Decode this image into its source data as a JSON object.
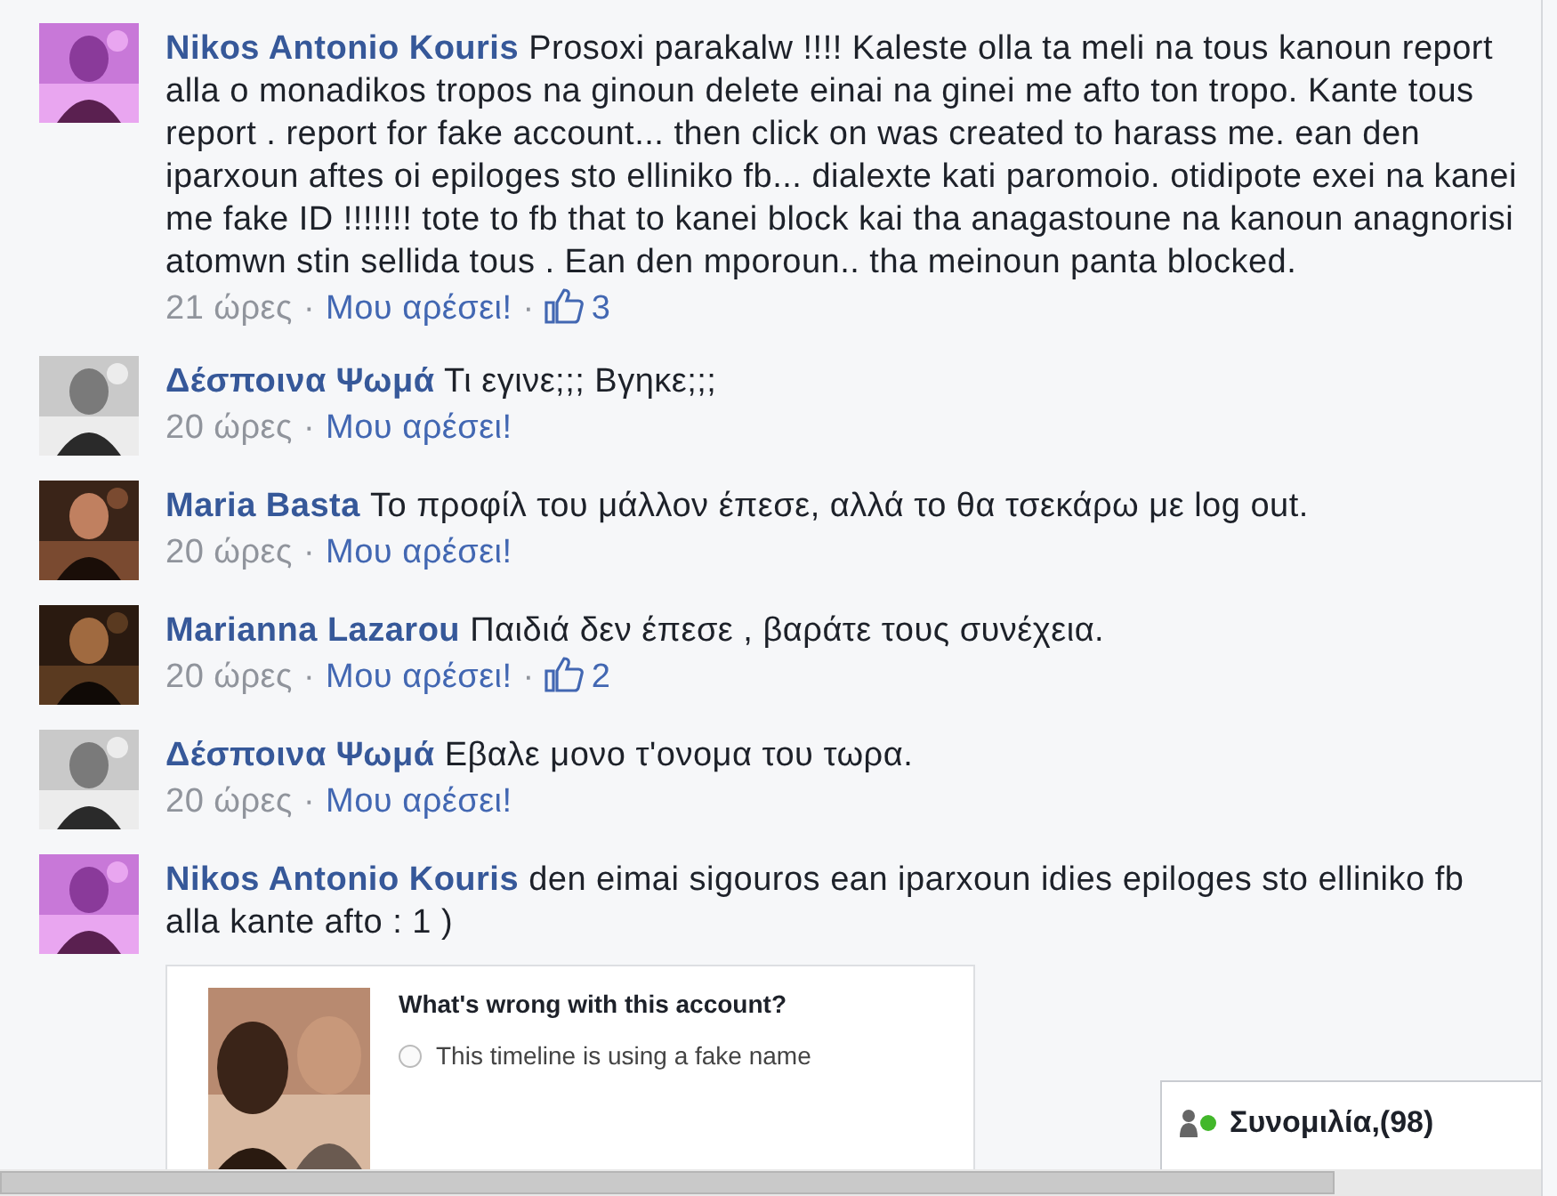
{
  "comments": [
    {
      "author": "Nikos Antonio Kouris",
      "text": "Prosoxi parakalw !!!! Kaleste olla ta meli na tous kanoun report alla o monadikos tropos na ginoun delete einai na ginei me afto ton tropo. Kante tous report . report for fake account... then click on was created to harass me. ean den iparxoun aftes oi epiloges sto elliniko fb... dialexte kati paromoio. otidipote exei na kanei me fake ID !!!!!!! tote to fb that to kanei block kai tha anagastoune na kanoun anagnorisi atomwn stin sellida tous . Ean den mporoun.. tha meinoun panta blocked.",
      "meta": [
        {
          "kind": "time",
          "text": "21 ώρες"
        },
        {
          "kind": "separator",
          "text": "·"
        },
        {
          "kind": "like",
          "text": "Μου αρέσει!"
        },
        {
          "kind": "separator",
          "text": "·"
        },
        {
          "kind": "count",
          "text": "3"
        }
      ]
    },
    {
      "author": "Δέσποινα Ψωμά",
      "text": "Τι εγινε;;; Βγηκε;;;",
      "meta": [
        {
          "kind": "time",
          "text": "20 ώρες"
        },
        {
          "kind": "separator",
          "text": "·"
        },
        {
          "kind": "like",
          "text": "Μου αρέσει!"
        }
      ]
    },
    {
      "author": "Maria Basta",
      "text": "Το προφίλ του μάλλον έπεσε, αλλά το θα τσεκάρω με log out.",
      "meta": [
        {
          "kind": "time",
          "text": "20 ώρες"
        },
        {
          "kind": "separator",
          "text": "·"
        },
        {
          "kind": "like",
          "text": "Μου αρέσει!"
        }
      ]
    },
    {
      "author": "Marianna Lazarou",
      "text": "Παιδιά δεν έπεσε , βαράτε τους συνέχεια.",
      "meta": [
        {
          "kind": "time",
          "text": "20 ώρες"
        },
        {
          "kind": "separator",
          "text": "·"
        },
        {
          "kind": "like",
          "text": "Μου αρέσει!"
        },
        {
          "kind": "separator",
          "text": "·"
        },
        {
          "kind": "count",
          "text": "2"
        }
      ]
    },
    {
      "author": "Δέσποινα Ψωμά",
      "text": "Εβαλε μονο τ'ονομα του τωρα.",
      "meta": [
        {
          "kind": "time",
          "text": "20 ώρες"
        },
        {
          "kind": "separator",
          "text": "·"
        },
        {
          "kind": "like",
          "text": "Μου αρέσει!"
        }
      ]
    },
    {
      "author": "Nikos Antonio Kouris",
      "text": "den eimai sigouros ean iparxoun idies epiloges sto elliniko fb alla kante afto : 1 )",
      "attachment": {
        "question": "What's wrong with this account?",
        "options": [
          {
            "label": "This timeline is using a fake name",
            "selected": false
          }
        ]
      }
    }
  ],
  "chat": {
    "label": "Συνομιλία,(98)"
  }
}
